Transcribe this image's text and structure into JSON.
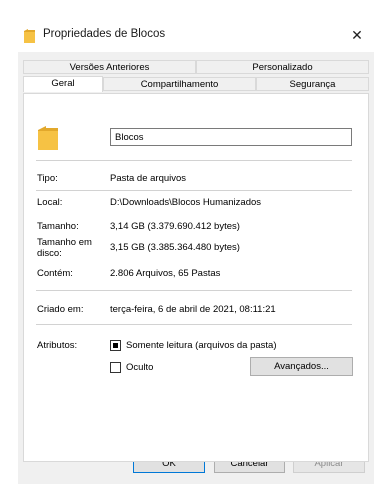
{
  "window": {
    "title": "Propriedades de Blocos",
    "title_icon": "folder-icon",
    "close_glyph": "✕"
  },
  "tabs": {
    "row1": [
      {
        "label": "Versões Anteriores"
      },
      {
        "label": "Personalizado"
      }
    ],
    "row2": [
      {
        "label": "Geral",
        "selected": true
      },
      {
        "label": "Compartilhamento"
      },
      {
        "label": "Segurança"
      }
    ]
  },
  "general": {
    "name_value": "Blocos",
    "rows": [
      {
        "label": "Tipo:",
        "value": "Pasta de arquivos"
      },
      {
        "label": "Local:",
        "value": "D:\\Downloads\\Blocos Humanizados"
      },
      {
        "label": "Tamanho:",
        "value": "3,14 GB (3.379.690.412 bytes)"
      },
      {
        "label": "Tamanho em disco:",
        "value": "3,15 GB (3.385.364.480 bytes)"
      },
      {
        "label": "Contém:",
        "value": "2.806 Arquivos, 65 Pastas"
      }
    ],
    "created_label": "Criado em:",
    "created_value": "terça-feira, 6 de abril de 2021, 08:11:21",
    "attributes_label": "Atributos:",
    "readonly_label": "Somente leitura (arquivos da pasta)",
    "readonly_state": "indeterminate",
    "hidden_label": "Oculto",
    "hidden_checked": false,
    "advanced_label": "Avançados..."
  },
  "footer": {
    "ok_label": "OK",
    "cancel_label": "Cancelar",
    "apply_label": "Aplicar",
    "apply_enabled": false
  },
  "colors": {
    "folder": "#f6c244",
    "folder_shade": "#e2a82b",
    "accent": "#0078d7"
  }
}
